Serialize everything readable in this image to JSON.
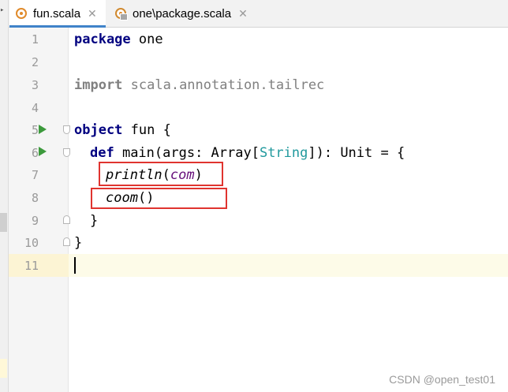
{
  "tabs": [
    {
      "label": "fun.scala",
      "active": true
    },
    {
      "label": "one\\package.scala",
      "active": false
    }
  ],
  "close_glyph": "✕",
  "line_numbers": [
    "1",
    "2",
    "3",
    "4",
    "5",
    "6",
    "7",
    "8",
    "9",
    "10",
    "11"
  ],
  "code": {
    "l1": {
      "kw": "package",
      "rest": " one"
    },
    "l3": {
      "kw": "import",
      "rest": " scala.annotation.tailrec"
    },
    "l5": {
      "kw": "object",
      "rest": " fun {"
    },
    "l6": {
      "kw": "def",
      "a": " main(args: Array[",
      "type": "String",
      "b": "]): Unit = {"
    },
    "l7": {
      "fn": "println",
      "open": "(",
      "arg": "com",
      "close": ")"
    },
    "l8": {
      "fn": "coom",
      "rest": "()"
    },
    "l9": {
      "text": "}"
    },
    "l10": {
      "text": "}"
    }
  },
  "watermark": "CSDN @open_test01",
  "colors": {
    "keyword": "#000080",
    "type": "#20999d",
    "highlight_box": "#e0342f",
    "run_icon": "#3c9a3c",
    "tab_underline": "#4083c9"
  },
  "icons": {
    "run": "run-gutter-icon",
    "fold": "fold-icon",
    "file": "scala-file-icon"
  }
}
